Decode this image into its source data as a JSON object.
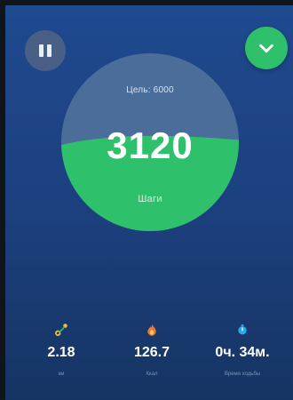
{
  "colors": {
    "background_top": "#1f4a8f",
    "progress_green": "#2ec06a",
    "remaining_blue": "#4a6d9a",
    "text_primary": "#ffffff",
    "text_secondary": "#7e93b8"
  },
  "controls": {
    "pause_icon": "pause-icon",
    "confirm_icon": "check-icon"
  },
  "gauge": {
    "goal_text": "Цель: 6000",
    "steps_value": "3120",
    "steps_unit": "Шаги",
    "progress_fraction": 0.52
  },
  "stats": [
    {
      "icon": "route-icon",
      "value": "2.18",
      "label": "км"
    },
    {
      "icon": "flame-icon",
      "value": "126.7",
      "label": "Ккал"
    },
    {
      "icon": "timer-icon",
      "value": "0ч. 34м.",
      "label": "Время ходьбы"
    }
  ]
}
